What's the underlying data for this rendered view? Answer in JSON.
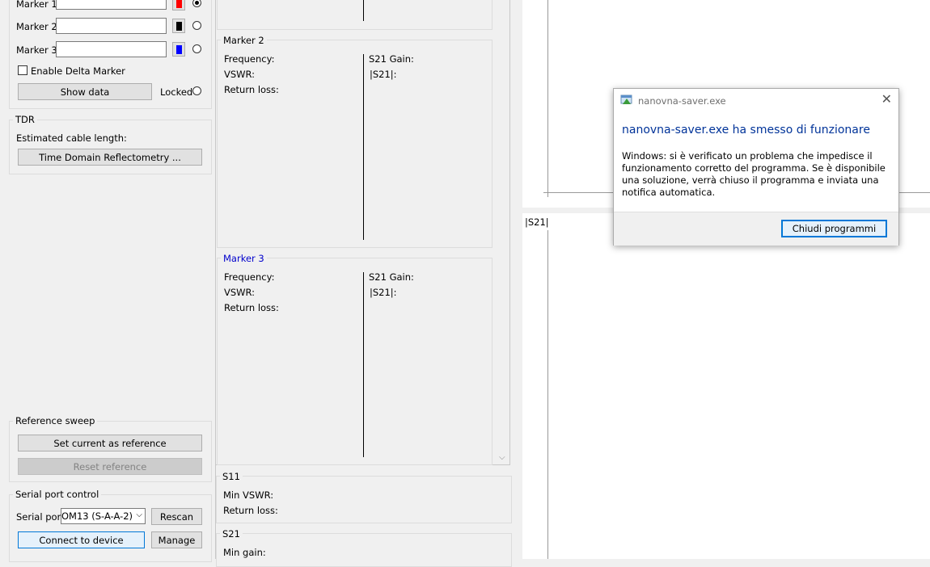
{
  "markers": {
    "m1_label": "Marker 1",
    "m2_label": "Marker 2",
    "m3_label": "Marker 3",
    "m1_color": "#ff0000",
    "m2_color": "#000000",
    "m3_color": "#0000ff",
    "enable_delta": "Enable Delta Marker",
    "show_data": "Show data",
    "locked": "Locked"
  },
  "tdr": {
    "title": "TDR",
    "cable_length": "Estimated cable length:",
    "button": "Time Domain Reflectometry ..."
  },
  "reference": {
    "title": "Reference sweep",
    "set_current": "Set current as reference",
    "reset": "Reset reference"
  },
  "serial": {
    "title": "Serial port control",
    "port_label": "Serial port",
    "port_value": "OM13 (S-A-A-2)",
    "rescan": "Rescan",
    "connect": "Connect to device",
    "manage": "Manage"
  },
  "marker_info": {
    "m2": {
      "title": "Marker 2",
      "frequency": "Frequency:",
      "vswr": "VSWR:",
      "return_loss": "Return loss:",
      "s21_gain": "S21 Gain:",
      "s21_abs": "|S21|:"
    },
    "m3": {
      "title": "Marker 3",
      "title_color": "#0000cc",
      "frequency": "Frequency:",
      "vswr": "VSWR:",
      "return_loss": "Return loss:",
      "s21_gain": "S21 Gain:",
      "s21_abs": "|S21|:"
    }
  },
  "s11": {
    "title": "S11",
    "min_vswr": "Min VSWR:",
    "return_loss": "Return loss:"
  },
  "s21": {
    "title": "S21",
    "min_gain": "Min gain:"
  },
  "chart": {
    "s21_label": "|S21|"
  },
  "dialog": {
    "app_title": "nanovna-saver.exe",
    "heading": "nanovna-saver.exe ha smesso di funzionare",
    "message": "Windows: si è verificato un problema che impedisce il funzionamento corretto del programma. Se è disponibile una soluzione, verrà chiuso il programma e inviata una notifica automatica.",
    "close_button": "Chiudi programmi",
    "heading_color": "#003399"
  }
}
